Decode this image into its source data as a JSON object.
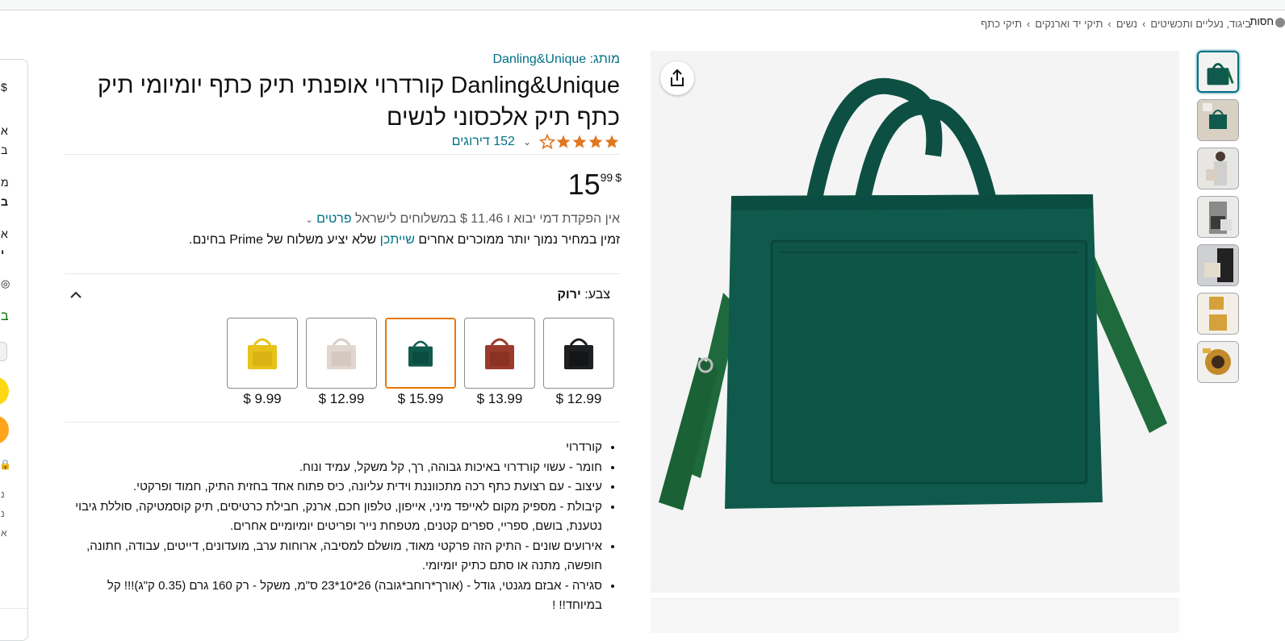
{
  "breadcrumb": [
    "ביגוד, נעליים ותכשיטים",
    "נשים",
    "תיקי יד וארנקים",
    "תיקי כתף"
  ],
  "cut_right_text": "חסות",
  "buybox_cut": {
    "lines": [
      "$",
      "א",
      "ב",
      "מ",
      "ב",
      "א",
      "י",
      "ב",
      "נ",
      "נ",
      "א"
    ]
  },
  "product": {
    "brand_link": "מותג: Danling&Unique",
    "title": "Danling&Unique קורדרוי אופנתי תיק כתף יומיומי תיק כתף תיק אלכסוני לנשים",
    "rating": 4.5,
    "rating_count": "152 דירוגים",
    "price_whole": "15",
    "price_fraction": "99",
    "currency": "$",
    "import_text": "אין הפקדת דמי יבוא ו 11.46 $ במשלוחים לישראל",
    "import_link": "פרטים",
    "prime_text_before": "זמין במחיר נמוך יותר ממוכרים אחרים",
    "prime_link": "שייתכן",
    "prime_text_after": "שלא יציע משלוח של Prime בחינם."
  },
  "color": {
    "label": "צבע:",
    "selected": "ירוק",
    "options": [
      {
        "name": "black",
        "price": "$ 12.99",
        "color": "#1e1f21"
      },
      {
        "name": "brown",
        "price": "$ 13.99",
        "color": "#9a3b2c"
      },
      {
        "name": "green",
        "price": "$ 15.99",
        "color": "#0f5a4c"
      },
      {
        "name": "beige",
        "price": "$ 12.99",
        "color": "#e0d6cf"
      },
      {
        "name": "yellow",
        "price": "$ 9.99",
        "color": "#e8c21a"
      }
    ]
  },
  "bullets": [
    "קורדרוי",
    "חומר - עשוי קורדרוי באיכות גבוהה, רך, קל משקל, עמיד ונוח.",
    "עיצוב - עם רצועת כתף רכה מתכווננת וידית עליונה, כיס פתוח אחד בחזית התיק, חמוד ופרקטי.",
    "קיבולת - מספיק מקום לאייפד מיני, אייפון, טלפון חכם, ארנק, חבילת כרטיסים, תיק קוסמטיקה, סוללת גיבוי נטענת, בושם, ספריי, ספרים קטנים, מטפחת נייר ופריטים יומיומיים אחרים.",
    "אירועים שונים - התיק הזה פרקטי מאוד, מושלם למסיבה, ארוחות ערב, מועדונים, דייטים, עבודה, חתונה, חופשה, מתנה או סתם כתיק יומיומי.",
    "סגירה - אבזם מגנטי, גודל - (אורך*רוחב*גובה) 26*10*23 ס\"מ, משקל - רק 160 גרם (0.35 ק\"ג)!!! קל במיוחד!! !"
  ],
  "colors": {
    "link": "#007185",
    "star": "#de7921",
    "selected_border": "#e77600",
    "bag_green": "#0f5a4c",
    "buy_yellow": "#ffd814",
    "buy_orange": "#ffa41c"
  }
}
